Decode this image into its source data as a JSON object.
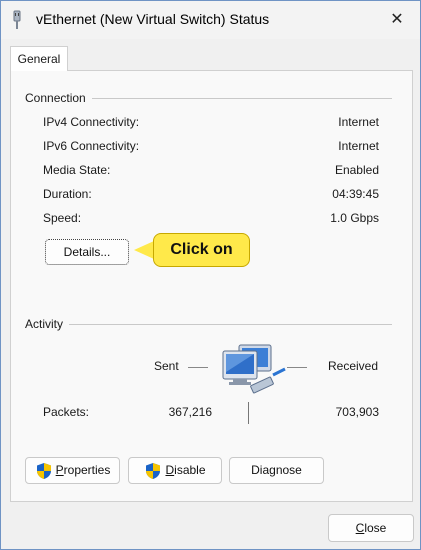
{
  "window": {
    "title": "vEthernet (New Virtual Switch) Status",
    "close_glyph": "✕"
  },
  "tabs": [
    {
      "label": "General"
    }
  ],
  "connection": {
    "heading": "Connection",
    "rows": [
      {
        "label": "IPv4 Connectivity:",
        "value": "Internet"
      },
      {
        "label": "IPv6 Connectivity:",
        "value": "Internet"
      },
      {
        "label": "Media State:",
        "value": "Enabled"
      },
      {
        "label": "Duration:",
        "value": "04:39:45"
      },
      {
        "label": "Speed:",
        "value": "1.0 Gbps"
      }
    ],
    "details_button": "Details...",
    "callout": "Click on"
  },
  "activity": {
    "heading": "Activity",
    "sent_label": "Sent",
    "received_label": "Received",
    "packets_label": "Packets:",
    "packets_sent": "367,216",
    "packets_received": "703,903"
  },
  "buttons": {
    "properties_prefix": "P",
    "properties_rest": "roperties",
    "disable_prefix": "D",
    "disable_rest": "isable",
    "diagnose": "Diagnose",
    "close_prefix": "C",
    "close_rest": "lose"
  },
  "icons": {
    "window": "network-adapter-icon",
    "shield": "uac-shield-icon",
    "network": "network-computers-icon"
  },
  "colors": {
    "callout": "#ffe94a",
    "accent": "#1a63c7"
  }
}
